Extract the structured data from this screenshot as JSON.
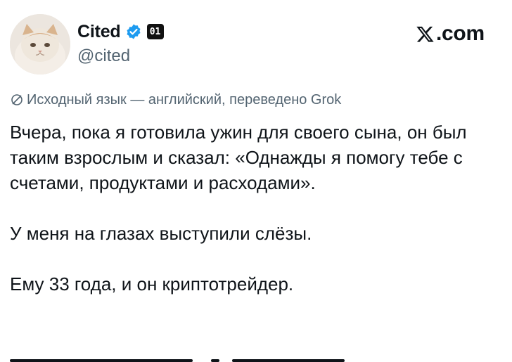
{
  "author": {
    "display_name": "Cited",
    "handle": "@cited",
    "affiliate_badge": "01",
    "verified_color": "#1d9bf0",
    "avatar_icon": "cat-avatar"
  },
  "brand": {
    "logo_text": ".com",
    "logo_icon": "x-logo-icon"
  },
  "translation_note": {
    "text": "Исходный язык — английский, переведено Grok",
    "icon": "slash-circle-icon"
  },
  "tweet": {
    "paragraphs": [
      "Вчера, пока я готовила ужин для своего сына, он был таким взрослым и сказал: «Однажды я помогу тебе с счетами, продуктами и расходами».",
      "У меня на глазах выступили слёзы.",
      "Ему 33 года, и он криптотрейдер."
    ]
  },
  "colors": {
    "text": "#0f1419",
    "secondary": "#536471",
    "accent": "#1d9bf0"
  }
}
